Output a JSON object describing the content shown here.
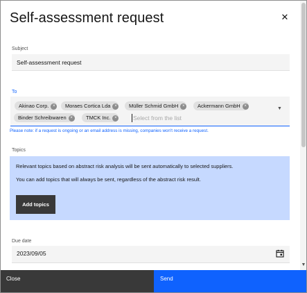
{
  "dialog": {
    "title": "Self-assessment request",
    "close_icon": "close-icon"
  },
  "subject": {
    "label": "Subject",
    "value": "Self-assessment request"
  },
  "to": {
    "label": "To",
    "tags": [
      "Akinao Corp.",
      "Moraes Cortica Lda",
      "Müller Schmid GmbH",
      "Ackermann GmbH",
      "Binder Schreibwaren",
      "TMCK Inc."
    ],
    "placeholder": "Select from the list",
    "note": "Please note: if a request is ongoing or an email address is missing, companies won't receive a request."
  },
  "topics": {
    "label": "Topics",
    "line1": "Relevant topics based on abstract risk analysis will be sent automatically to selected suppliers.",
    "line2": "You can add topics that will always be sent, regardless of the abstract risk result.",
    "add_button": "Add topics"
  },
  "due_date": {
    "label": "Due date",
    "value": "2023/09/05",
    "icon": "calendar-icon"
  },
  "footer": {
    "close_label": "Close",
    "send_label": "Send"
  },
  "colors": {
    "primary": "#0f62fe",
    "topics_bg": "#c6d9ff",
    "footer_secondary": "#393939"
  }
}
